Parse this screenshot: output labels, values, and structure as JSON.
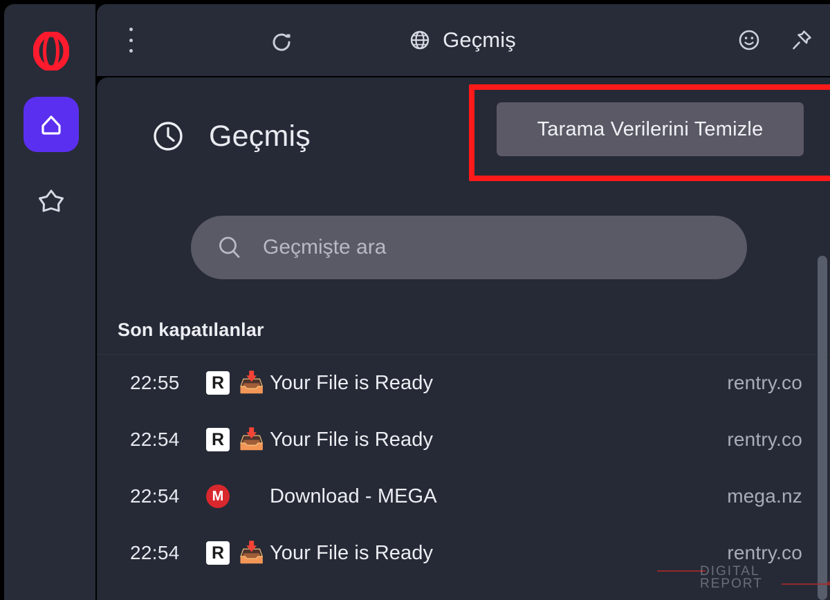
{
  "window": {
    "background_color": "#000000",
    "sidebar_color": "#282c38",
    "content_color": "#262a36",
    "accent_color": "#5b2ff0",
    "opera_red": "#ff1b2d",
    "annotation_color": "#ff1a1a"
  },
  "sidebar": {
    "logo_name": "opera-logo",
    "items": [
      {
        "id": "home",
        "icon": "home-icon",
        "active": true
      },
      {
        "id": "favorites",
        "icon": "star-icon",
        "active": false
      }
    ]
  },
  "topbar": {
    "menu_icon": "three-dots-vertical-icon",
    "reload_icon": "reload-icon",
    "tab_icon": "globe-icon",
    "tab_title": "Geçmiş",
    "right_icons": [
      {
        "id": "emoji",
        "icon": "smiley-face-icon"
      },
      {
        "id": "pin",
        "icon": "pin-icon"
      }
    ]
  },
  "page": {
    "icon": "clock-icon",
    "title": "Geçmiş",
    "clear_button_label": "Tarama Verilerini Temizle"
  },
  "search": {
    "icon": "search-icon",
    "value": "",
    "placeholder": "Geçmişte ara"
  },
  "history": {
    "section_title": "Son kapatılanlar",
    "rows": [
      {
        "time": "22:55",
        "favicon": "rentry-favicon",
        "favicon_letter": "R",
        "favicon_type": "square",
        "emoji": "📥",
        "title": "Your File is Ready",
        "domain": "rentry.co"
      },
      {
        "time": "22:54",
        "favicon": "rentry-favicon",
        "favicon_letter": "R",
        "favicon_type": "square",
        "emoji": "📥",
        "title": "Your File is Ready",
        "domain": "rentry.co"
      },
      {
        "time": "22:54",
        "favicon": "mega-favicon",
        "favicon_letter": "M",
        "favicon_type": "circle",
        "emoji": "",
        "title": "Download - MEGA",
        "domain": "mega.nz"
      },
      {
        "time": "22:54",
        "favicon": "rentry-favicon",
        "favicon_letter": "R",
        "favicon_type": "square",
        "emoji": "📥",
        "title": "Your File is Ready",
        "domain": "rentry.co"
      }
    ]
  },
  "watermark": {
    "line1": "DIGITAL",
    "line2": "REPORT"
  }
}
